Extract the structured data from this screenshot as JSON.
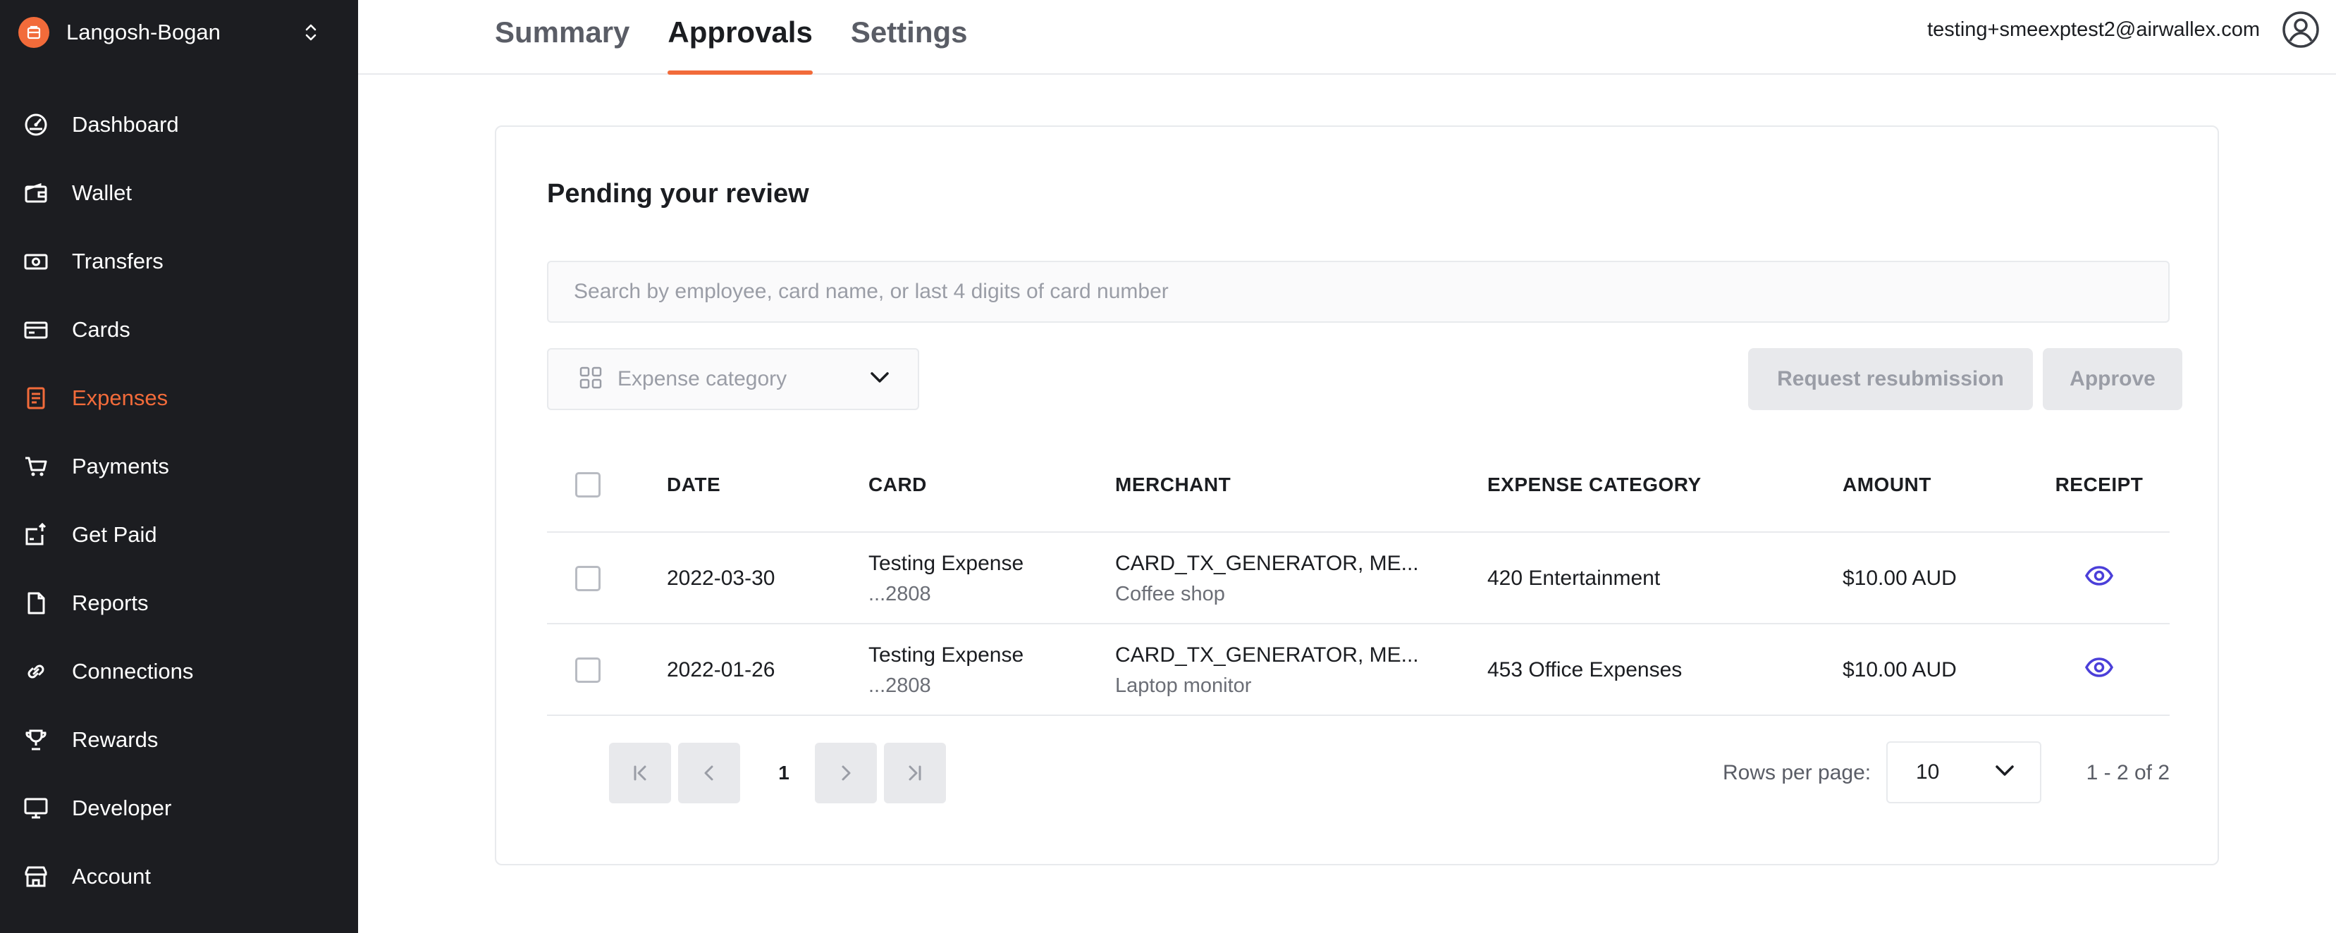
{
  "sidebar": {
    "org_name": "Langosh-Bogan",
    "items": [
      {
        "label": "Dashboard",
        "icon": "dashboard-icon"
      },
      {
        "label": "Wallet",
        "icon": "wallet-icon"
      },
      {
        "label": "Transfers",
        "icon": "transfers-icon"
      },
      {
        "label": "Cards",
        "icon": "card-icon"
      },
      {
        "label": "Expenses",
        "icon": "expenses-icon",
        "active": true
      },
      {
        "label": "Payments",
        "icon": "cart-icon"
      },
      {
        "label": "Get Paid",
        "icon": "get-paid-icon"
      },
      {
        "label": "Reports",
        "icon": "reports-icon"
      },
      {
        "label": "Connections",
        "icon": "link-icon"
      },
      {
        "label": "Rewards",
        "icon": "trophy-icon"
      },
      {
        "label": "Developer",
        "icon": "monitor-icon"
      },
      {
        "label": "Account",
        "icon": "store-icon"
      }
    ]
  },
  "header": {
    "tabs": [
      {
        "label": "Summary"
      },
      {
        "label": "Approvals",
        "active": true
      },
      {
        "label": "Settings"
      }
    ],
    "user_email": "testing+smeexptest2@airwallex.com"
  },
  "main": {
    "title": "Pending your review",
    "search_placeholder": "Search by employee, card name, or last 4 digits of card number",
    "category_filter_placeholder": "Expense category",
    "actions": {
      "resubmit": "Request resubmission",
      "approve": "Approve"
    },
    "table": {
      "columns": {
        "date": "DATE",
        "card": "CARD",
        "merchant": "MERCHANT",
        "category": "EXPENSE CATEGORY",
        "amount": "AMOUNT",
        "receipt": "RECEIPT"
      },
      "rows": [
        {
          "date": "2022-03-30",
          "card_name": "Testing Expense",
          "card_last4": "...2808",
          "merchant": "CARD_TX_GENERATOR, ME...",
          "description": "Coffee shop",
          "category": "420 Entertainment",
          "amount": "$10.00 AUD"
        },
        {
          "date": "2022-01-26",
          "card_name": "Testing Expense",
          "card_last4": "...2808",
          "merchant": "CARD_TX_GENERATOR, ME...",
          "description": "Laptop monitor",
          "category": "453 Office Expenses",
          "amount": "$10.00 AUD"
        }
      ]
    },
    "pagination": {
      "current_page": "1",
      "rows_per_page_label": "Rows per page:",
      "rows_per_page": "10",
      "range": "1 - 2 of 2"
    }
  },
  "colors": {
    "accent": "#f26b3a",
    "receipt_icon": "#4b3fd9",
    "sidebar_bg": "#1c1d21"
  }
}
